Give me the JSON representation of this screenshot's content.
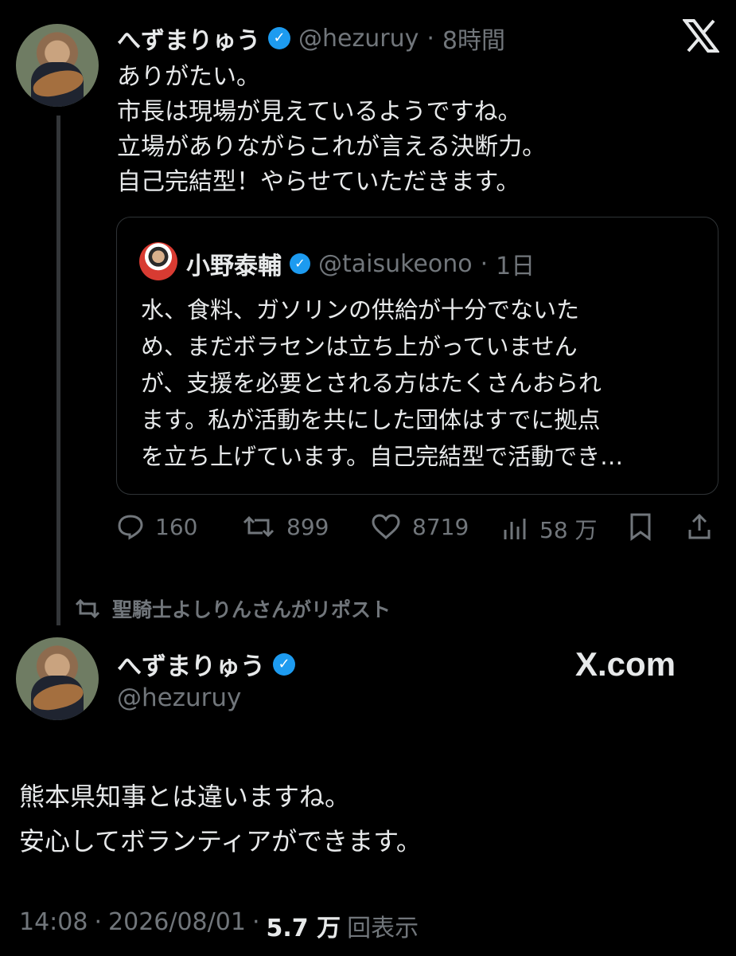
{
  "top_tweet": {
    "author_name": "へずまりゅう",
    "handle": "@hezuruy",
    "age": "8時間",
    "body": "ありがたい。\n市長は現場が見えているようですね。\n立場がありながらこれが言える決断力。\n自己完結型！やらせていただきます。",
    "quote": {
      "author_name": "小野泰輔",
      "handle": "@taisukeono",
      "age": "1日",
      "body": "水、食料、ガソリンの供給が十分でないた\nめ、まだボラセンは立ち上がっていません\nが、支援を必要とされる方はたくさんおられ\nます。私が活動を共にした団体はすでに拠点\nを立ち上げています。自己完結型で活動でき…"
    },
    "stats": {
      "replies": "160",
      "reposts": "899",
      "likes": "8719",
      "views": "58 万"
    }
  },
  "repost_notice": "聖騎士よしりんさんがリポスト",
  "main_tweet": {
    "author_name": "へずまりゅう",
    "handle": "@hezuruy",
    "brand": "X.com",
    "body_line1": "熊本県知事とは違いますね。",
    "body_line2": "安心してボランティアができます。",
    "time": "14:08",
    "date": "2026/08/01",
    "views_count": "5.7 万",
    "views_label": "回表示"
  },
  "icons": {
    "top_right": "x-logo-icon",
    "reply": "reply-icon",
    "repost": "repost-icon",
    "like": "heart-icon",
    "views": "views-icon",
    "bookmark": "bookmark-icon",
    "share": "share-icon"
  },
  "colors": {
    "background": "#000000",
    "text": "#e7e9ea",
    "muted": "#71767b",
    "verified": "#1d9bf0",
    "border": "#2f3336"
  }
}
